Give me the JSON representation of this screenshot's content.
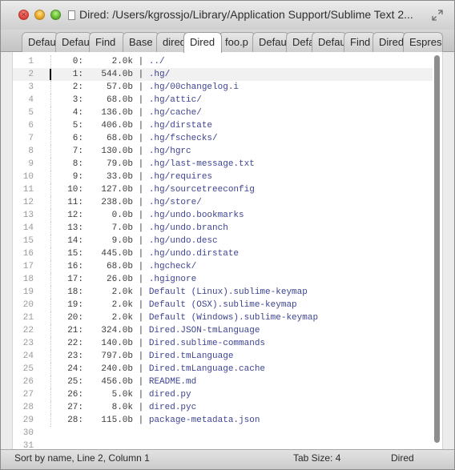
{
  "window": {
    "title": "Dired: /Users/kgrossjo/Library/Application Support/Sublime Text 2..."
  },
  "tabs": [
    {
      "label": "Default",
      "active": false
    },
    {
      "label": "Default",
      "active": false
    },
    {
      "label": "Find",
      "active": false
    },
    {
      "label": "Base",
      "active": false
    },
    {
      "label": "dired",
      "active": false
    },
    {
      "label": "Dired",
      "active": true
    },
    {
      "label": "foo.p",
      "active": false
    },
    {
      "label": "Default",
      "active": false
    },
    {
      "label": "Default",
      "active": false
    },
    {
      "label": "Default",
      "active": false
    },
    {
      "label": "Find",
      "active": false
    },
    {
      "label": "Dired",
      "active": false
    },
    {
      "label": "Espres",
      "active": false
    }
  ],
  "editor": {
    "current_line": 2,
    "lines": [
      {
        "num": "1",
        "idx": "0:",
        "size": "2.0k",
        "name": "../"
      },
      {
        "num": "2",
        "idx": "1:",
        "size": "544.0b",
        "name": ".hg/"
      },
      {
        "num": "3",
        "idx": "2:",
        "size": "57.0b",
        "name": ".hg/00changelog.i"
      },
      {
        "num": "4",
        "idx": "3:",
        "size": "68.0b",
        "name": ".hg/attic/"
      },
      {
        "num": "5",
        "idx": "4:",
        "size": "136.0b",
        "name": ".hg/cache/"
      },
      {
        "num": "6",
        "idx": "5:",
        "size": "406.0b",
        "name": ".hg/dirstate"
      },
      {
        "num": "7",
        "idx": "6:",
        "size": "68.0b",
        "name": ".hg/fschecks/"
      },
      {
        "num": "8",
        "idx": "7:",
        "size": "130.0b",
        "name": ".hg/hgrc"
      },
      {
        "num": "9",
        "idx": "8:",
        "size": "79.0b",
        "name": ".hg/last-message.txt"
      },
      {
        "num": "10",
        "idx": "9:",
        "size": "33.0b",
        "name": ".hg/requires"
      },
      {
        "num": "11",
        "idx": "10:",
        "size": "127.0b",
        "name": ".hg/sourcetreeconfig"
      },
      {
        "num": "12",
        "idx": "11:",
        "size": "238.0b",
        "name": ".hg/store/"
      },
      {
        "num": "13",
        "idx": "12:",
        "size": "0.0b",
        "name": ".hg/undo.bookmarks"
      },
      {
        "num": "14",
        "idx": "13:",
        "size": "7.0b",
        "name": ".hg/undo.branch"
      },
      {
        "num": "15",
        "idx": "14:",
        "size": "9.0b",
        "name": ".hg/undo.desc"
      },
      {
        "num": "16",
        "idx": "15:",
        "size": "445.0b",
        "name": ".hg/undo.dirstate"
      },
      {
        "num": "17",
        "idx": "16:",
        "size": "68.0b",
        "name": ".hgcheck/"
      },
      {
        "num": "18",
        "idx": "17:",
        "size": "26.0b",
        "name": ".hgignore"
      },
      {
        "num": "19",
        "idx": "18:",
        "size": "2.0k",
        "name": "Default (Linux).sublime-keymap"
      },
      {
        "num": "20",
        "idx": "19:",
        "size": "2.0k",
        "name": "Default (OSX).sublime-keymap"
      },
      {
        "num": "21",
        "idx": "20:",
        "size": "2.0k",
        "name": "Default (Windows).sublime-keymap"
      },
      {
        "num": "22",
        "idx": "21:",
        "size": "324.0b",
        "name": "Dired.JSON-tmLanguage"
      },
      {
        "num": "23",
        "idx": "22:",
        "size": "140.0b",
        "name": "Dired.sublime-commands"
      },
      {
        "num": "24",
        "idx": "23:",
        "size": "797.0b",
        "name": "Dired.tmLanguage"
      },
      {
        "num": "25",
        "idx": "24:",
        "size": "240.0b",
        "name": "Dired.tmLanguage.cache"
      },
      {
        "num": "26",
        "idx": "25:",
        "size": "456.0b",
        "name": "README.md"
      },
      {
        "num": "27",
        "idx": "26:",
        "size": "5.0k",
        "name": "dired.py"
      },
      {
        "num": "28",
        "idx": "27:",
        "size": "8.0k",
        "name": "dired.pyc"
      },
      {
        "num": "29",
        "idx": "28:",
        "size": "115.0b",
        "name": "package-metadata.json"
      },
      {
        "num": "30",
        "idx": "",
        "size": "",
        "name": ""
      },
      {
        "num": "31",
        "idx": "",
        "size": "",
        "name": ""
      }
    ]
  },
  "statusbar": {
    "left": "Sort by name, Line 2, Column 1",
    "tab_size": "Tab Size: 4",
    "syntax": "Dired"
  }
}
